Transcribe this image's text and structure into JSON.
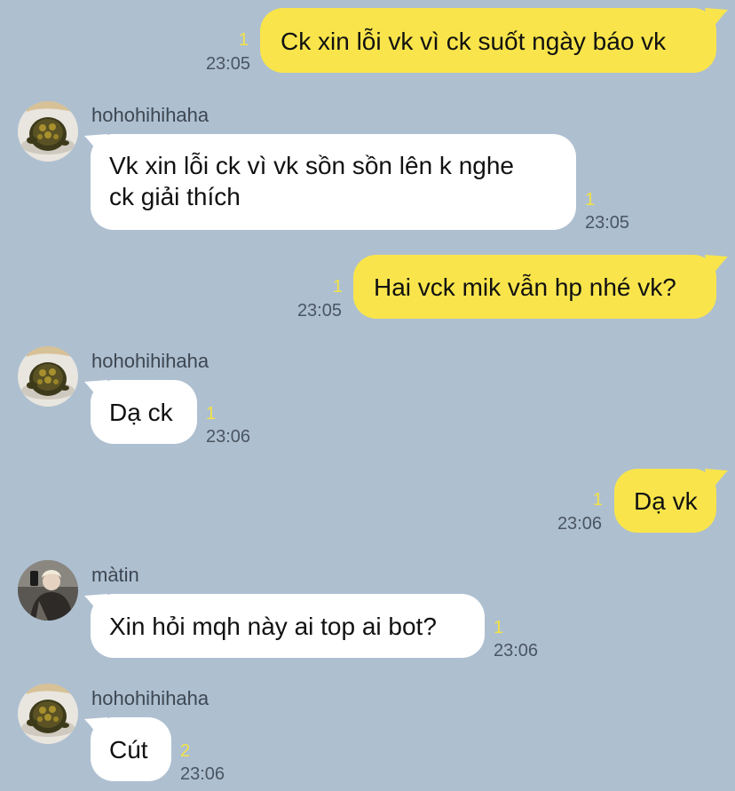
{
  "messages": [
    {
      "direction": "outgoing",
      "text": "Ck xin lỗi vk vì ck suốt ngày báo vk",
      "unread": "1",
      "time": "23:05"
    },
    {
      "direction": "incoming",
      "sender": "hohohihihaha",
      "avatar": "turtle-avatar",
      "lines": [
        "Vk xin lỗi ck vì vk sồn sồn lên k nghe",
        "ck giải thích"
      ],
      "unread": "1",
      "time": "23:05"
    },
    {
      "direction": "outgoing",
      "text": "Hai vck mik vẫn hp nhé vk?",
      "unread": "1",
      "time": "23:05"
    },
    {
      "direction": "incoming",
      "sender": "hohohihihaha",
      "avatar": "turtle-avatar",
      "text": "Dạ ck",
      "unread": "1",
      "time": "23:06"
    },
    {
      "direction": "outgoing",
      "text": "Dạ vk",
      "unread": "1",
      "time": "23:06"
    },
    {
      "direction": "incoming",
      "sender": "màtin",
      "avatar": "person-selfie-avatar",
      "text": "Xin hỏi mqh này ai top ai bot?",
      "unread": "1",
      "time": "23:06"
    },
    {
      "direction": "incoming",
      "sender": "hohohihihaha",
      "avatar": "turtle-avatar",
      "text": "Cút",
      "unread": "2",
      "time": "23:06"
    }
  ],
  "colors": {
    "background": "#aebfd0",
    "outgoing_bubble": "#f9e54b",
    "incoming_bubble": "#ffffff",
    "unread_count": "#f3e245",
    "timestamp": "#4a5561"
  }
}
